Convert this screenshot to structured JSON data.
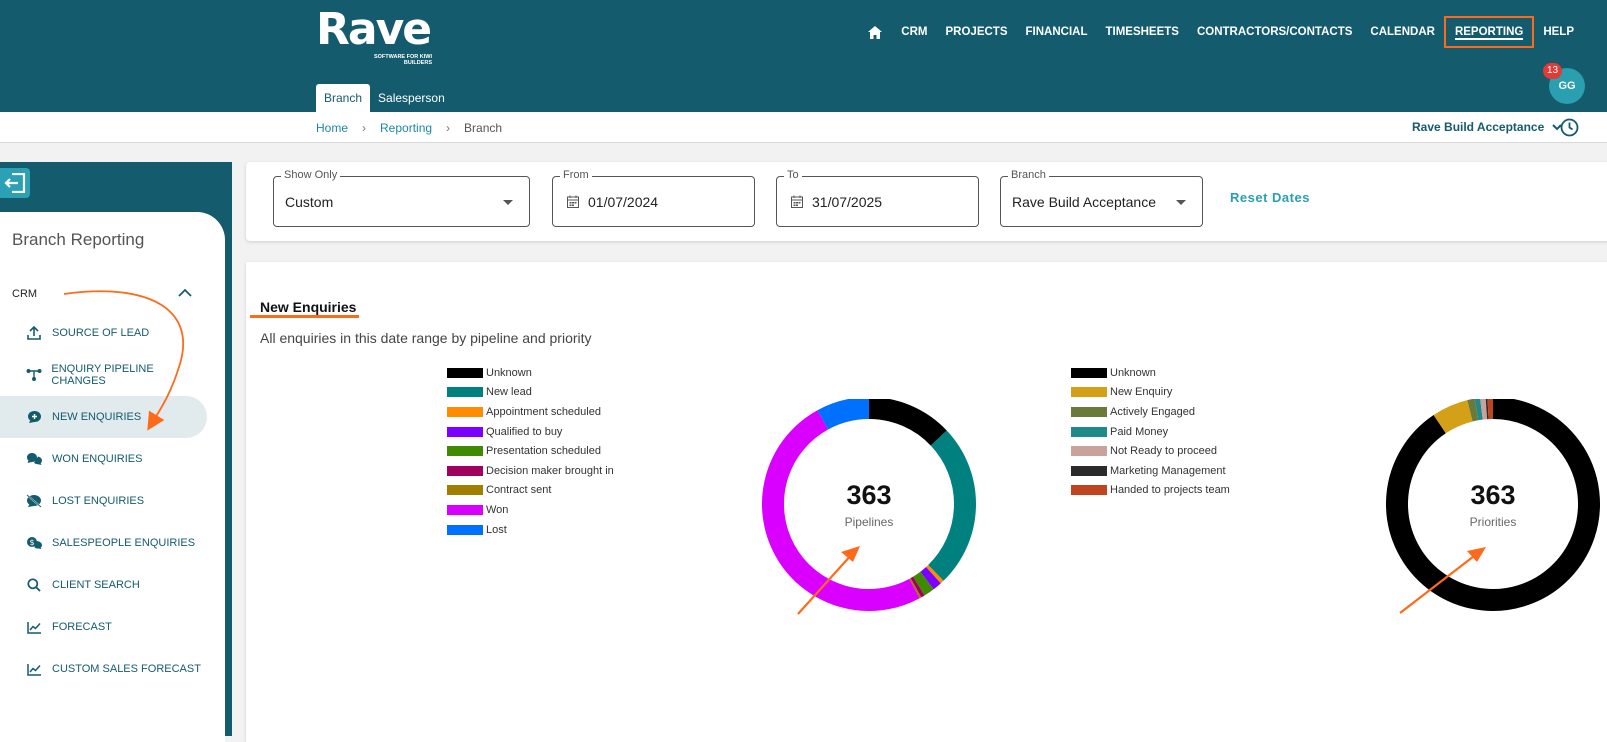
{
  "header": {
    "logo_text": "Rave",
    "logo_tagline": "SOFTWARE FOR KIWI BUILDERS",
    "nav": [
      {
        "label": "CRM"
      },
      {
        "label": "PROJECTS"
      },
      {
        "label": "FINANCIAL"
      },
      {
        "label": "TIMESHEETS"
      },
      {
        "label": "CONTRACTORS/CONTACTS"
      },
      {
        "label": "CALENDAR"
      },
      {
        "label": "REPORTING"
      },
      {
        "label": "HELP"
      }
    ],
    "subtabs": [
      {
        "label": "Branch"
      },
      {
        "label": "Salesperson"
      }
    ],
    "avatar_initials": "GG",
    "notification_count": "13"
  },
  "breadcrumb": {
    "items": [
      "Home",
      "Reporting",
      "Branch"
    ],
    "separator": "›"
  },
  "company_selector": "Rave Build Acceptance",
  "sidebar": {
    "title": "Branch Reporting",
    "section": "CRM",
    "items": [
      {
        "label": "SOURCE OF LEAD",
        "icon": "upload-icon"
      },
      {
        "label": "ENQUIRY PIPELINE CHANGES",
        "icon": "pipeline-icon"
      },
      {
        "label": "NEW ENQUIRIES",
        "icon": "chat-plus-icon"
      },
      {
        "label": "WON ENQUIRIES",
        "icon": "chat-double-icon"
      },
      {
        "label": "LOST ENQUIRIES",
        "icon": "chat-off-icon"
      },
      {
        "label": "SALESPEOPLE ENQUIRIES",
        "icon": "dollar-chat-icon"
      },
      {
        "label": "CLIENT SEARCH",
        "icon": "search-icon"
      },
      {
        "label": "FORECAST",
        "icon": "line-chart-icon"
      },
      {
        "label": "CUSTOM SALES FORECAST",
        "icon": "line-chart-icon"
      }
    ]
  },
  "filters": {
    "show_only": {
      "label": "Show Only",
      "value": "Custom"
    },
    "from": {
      "label": "From",
      "value": "01/07/2024"
    },
    "to": {
      "label": "To",
      "value": "31/07/2025"
    },
    "branch": {
      "label": "Branch",
      "value": "Rave Build Acceptance"
    },
    "reset_label": "Reset Dates"
  },
  "report": {
    "title": "New Enquiries",
    "subtitle": "All enquiries in this date range by pipeline and priority"
  },
  "colors": {
    "brand": "#145b6d",
    "accent": "#ff6a1a",
    "link": "#1d8aa0"
  },
  "chart_data": [
    {
      "type": "pie",
      "center_value": "363",
      "center_label": "Pipelines",
      "labels": [
        "Unknown",
        "New lead",
        "Appointment scheduled",
        "Qualified to buy",
        "Presentation scheduled",
        "Decision maker brought in",
        "Contract sent",
        "Won",
        "Lost"
      ],
      "colors": [
        "#000000",
        "#00807f",
        "#ff8c00",
        "#7b00ff",
        "#3e8a00",
        "#a0005e",
        "#a07f00",
        "#d900ff",
        "#0071ff"
      ],
      "values": [
        47,
        90,
        2,
        5,
        6,
        2,
        1,
        181,
        29
      ],
      "legend_position": "left"
    },
    {
      "type": "pie",
      "center_value": "363",
      "center_label": "Priorities",
      "labels": [
        "Unknown",
        "New Enquiry",
        "Actively Engaged",
        "Paid Money",
        "Not Ready to proceed",
        "Marketing Management",
        "Handed to projects team"
      ],
      "colors": [
        "#000000",
        "#d4a017",
        "#6b7a3a",
        "#1f8a8a",
        "#c9a29b",
        "#2b2b2b",
        "#c0441d"
      ],
      "values": [
        329,
        20,
        4,
        3,
        3,
        1,
        3
      ],
      "legend_position": "left"
    }
  ]
}
